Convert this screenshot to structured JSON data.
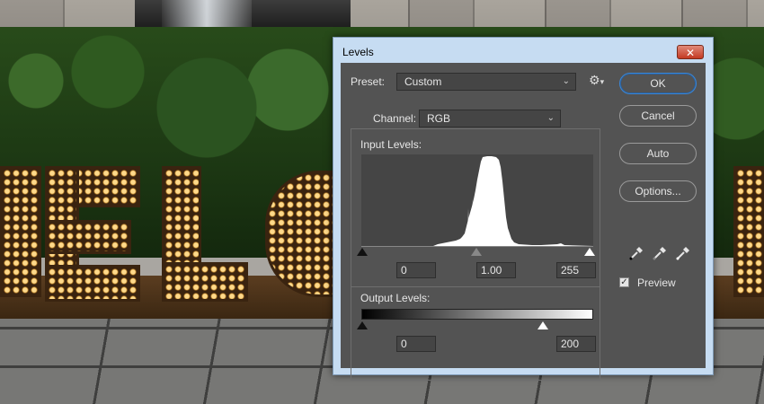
{
  "dialog": {
    "title": "Levels",
    "close_glyph": "✕",
    "preset_label": "Preset:",
    "preset_value": "Custom",
    "settings_icon": "gear-icon",
    "channel_label": "Channel:",
    "channel_value": "RGB",
    "input_levels_label": "Input Levels:",
    "input_black": "0",
    "input_gamma": "1.00",
    "input_white": "255",
    "output_levels_label": "Output Levels:",
    "output_black": "0",
    "output_white": "200",
    "buttons": {
      "ok": "OK",
      "cancel": "Cancel",
      "auto": "Auto",
      "options": "Options..."
    },
    "preview_label": "Preview",
    "preview_checked": true,
    "accent_color": "#3b86d6"
  }
}
